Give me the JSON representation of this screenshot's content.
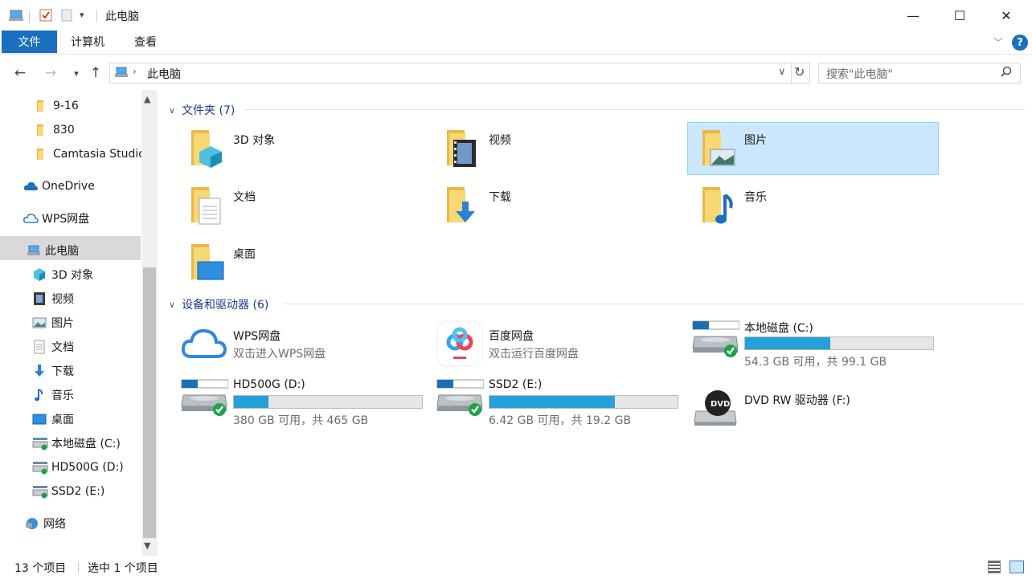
{
  "window": {
    "title": "此电脑",
    "quick_access_icons": [
      "computer-icon",
      "properties-checkbox-icon",
      "new-folder-icon",
      "customize-dropdown-icon"
    ],
    "controls": {
      "minimize": "—",
      "maximize": "☐",
      "close": "✕"
    }
  },
  "ribbon": {
    "tabs": [
      "文件",
      "计算机",
      "查看"
    ],
    "help": "?"
  },
  "nav": {
    "address_path": "此电脑",
    "search_placeholder": "搜索\"此电脑\""
  },
  "sidebar": {
    "items": [
      {
        "label": "9-16",
        "icon": "folder-icon"
      },
      {
        "label": "830",
        "icon": "folder-icon"
      },
      {
        "label": "Camtasia Studio",
        "icon": "folder-icon"
      },
      {
        "label": "OneDrive",
        "icon": "cloud-icon"
      },
      {
        "label": "WPS网盘",
        "icon": "wps-cloud-icon"
      },
      {
        "label": "此电脑",
        "icon": "computer-icon",
        "selected": true
      },
      {
        "label": "3D 对象",
        "icon": "3d-object-icon"
      },
      {
        "label": "视频",
        "icon": "video-icon"
      },
      {
        "label": "图片",
        "icon": "picture-icon"
      },
      {
        "label": "文档",
        "icon": "document-icon"
      },
      {
        "label": "下载",
        "icon": "download-icon"
      },
      {
        "label": "音乐",
        "icon": "music-icon"
      },
      {
        "label": "桌面",
        "icon": "desktop-icon"
      },
      {
        "label": "本地磁盘 (C:)",
        "icon": "drive-icon"
      },
      {
        "label": "HD500G (D:)",
        "icon": "drive-icon"
      },
      {
        "label": "SSD2 (E:)",
        "icon": "drive-icon"
      },
      {
        "label": "网络",
        "icon": "network-icon"
      }
    ]
  },
  "content": {
    "folders_header": "文件夹 (7)",
    "folders": [
      {
        "label": "3D 对象",
        "icon": "3d-object-icon"
      },
      {
        "label": "视频",
        "icon": "video-icon"
      },
      {
        "label": "图片",
        "icon": "picture-icon",
        "selected": true
      },
      {
        "label": "文档",
        "icon": "document-icon"
      },
      {
        "label": "下载",
        "icon": "download-icon"
      },
      {
        "label": "音乐",
        "icon": "music-icon"
      },
      {
        "label": "桌面",
        "icon": "desktop-icon"
      }
    ],
    "devices_header": "设备和驱动器 (6)",
    "devices": [
      {
        "label": "WPS网盘",
        "sub": "双击进入WPS网盘",
        "icon": "wps-cloud-icon"
      },
      {
        "label": "百度网盘",
        "sub": "双击运行百度网盘",
        "icon": "baidu-netdisk-icon"
      },
      {
        "label": "本地磁盘 (C:)",
        "sub": "54.3 GB 可用，共 99.1 GB",
        "icon": "drive-icon",
        "used_fraction": 0.452
      },
      {
        "label": "HD500G (D:)",
        "sub": "380 GB 可用，共 465 GB",
        "icon": "drive-icon",
        "used_fraction": 0.183
      },
      {
        "label": "SSD2 (E:)",
        "sub": "6.42 GB 可用，共 19.2 GB",
        "icon": "drive-icon",
        "used_fraction": 0.666
      },
      {
        "label": "DVD RW 驱动器 (F:)",
        "sub": "",
        "icon": "dvd-drive-icon",
        "badge": "DVD"
      }
    ]
  },
  "status": {
    "item_count": "13 个项目",
    "selected_count": "选中 1 个项目"
  },
  "colors": {
    "accent": "#1a6fc0",
    "selection_bg": "#cce8ff",
    "drive_fill": "#26a0da",
    "folder": "#f8d775"
  }
}
